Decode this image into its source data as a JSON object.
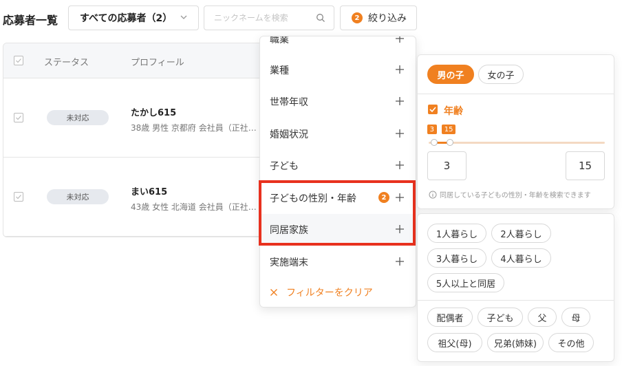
{
  "header": {
    "title": "応募者一覧",
    "select_label": "すべての応募者（2）",
    "search_placeholder": "ニックネームを検索",
    "filter_count": "2",
    "filter_label": "絞り込み"
  },
  "table": {
    "col_status": "ステータス",
    "col_profile": "プロフィール",
    "rows": [
      {
        "status": "未対応",
        "name": "たかし615",
        "meta": "38歳 男性 京都府 会社員（正社…"
      },
      {
        "status": "未対応",
        "name": "まい615",
        "meta": "43歳 女性 北海道 会社員（正社…"
      }
    ]
  },
  "menu": {
    "items": [
      {
        "label": "職業"
      },
      {
        "label": "業種"
      },
      {
        "label": "世帯年収"
      },
      {
        "label": "婚姻状況"
      },
      {
        "label": "子ども"
      },
      {
        "label": "子どもの性別・年齢",
        "badge": "2"
      },
      {
        "label": "同居家族"
      },
      {
        "label": "実施端末"
      }
    ],
    "clear_label": "フィルターをクリア"
  },
  "child_filter": {
    "gender_male": "男の子",
    "gender_female": "女の子",
    "age_label": "年齢",
    "min_age": "3",
    "max_age": "15",
    "slider_min_fraction": 0.03,
    "slider_max_fraction": 0.12,
    "hint": "同居している子どもの性別・年齢を検索できます"
  },
  "household_filter": {
    "size_options": [
      "1人暮らし",
      "2人暮らし",
      "3人暮らし",
      "4人暮らし",
      "5人以上と同居"
    ],
    "member_options": [
      "配偶者",
      "子ども",
      "父",
      "母",
      "祖父(母)",
      "兄弟(姉妹)",
      "その他"
    ]
  },
  "colors": {
    "accent": "#f08020",
    "highlight": "#e8311e"
  }
}
